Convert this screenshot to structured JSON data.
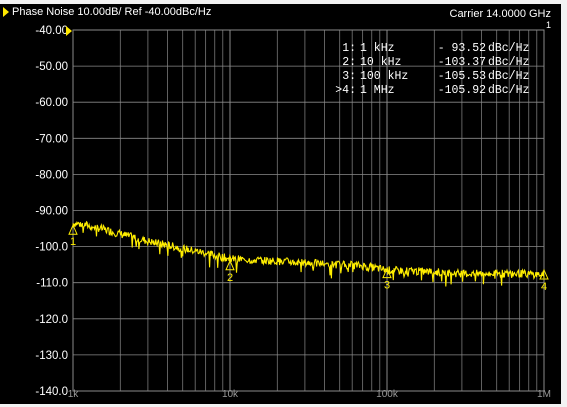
{
  "header": {
    "title": "Phase Noise 10.00dB/ Ref -40.00dBc/Hz",
    "carrier": "Carrier 14.0000 GHz",
    "channel": "1"
  },
  "markers": [
    {
      "label": "1:",
      "freq": "1 kHz",
      "value": "- 93.52",
      "unit": "dBc/Hz",
      "id": "1"
    },
    {
      "label": "2:",
      "freq": "10 kHz",
      "value": "-103.37",
      "unit": "dBc/Hz",
      "id": "2"
    },
    {
      "label": "3:",
      "freq": "100 kHz",
      "value": "-105.53",
      "unit": "dBc/Hz",
      "id": "3"
    },
    {
      "label": ">4:",
      "freq": "1 MHz",
      "value": "-105.92",
      "unit": "dBc/Hz",
      "id": "4"
    }
  ],
  "colors": {
    "trace": "#ffee00",
    "grid": "#8a8a8a",
    "text": "#ffffff",
    "marker": "#ffee00"
  },
  "chart_data": {
    "type": "line",
    "title": "Phase Noise 10.00dB/ Ref -40.00dBc/Hz",
    "xscale": "log",
    "xlim": [
      1000,
      1000000
    ],
    "ylim": [
      -140,
      -40
    ],
    "ytick_labels": [
      "-40.00",
      "-50.00",
      "-60.00",
      "-70.00",
      "-80.00",
      "-90.00",
      "-100.0",
      "-110.0",
      "-120.0",
      "-130.0",
      "-140.0"
    ],
    "xtick_labels": [
      "1k",
      "10k",
      "100k",
      "1M"
    ],
    "grid": true,
    "series": [
      {
        "x": [
          1000,
          1200,
          1500,
          2000,
          3000,
          5000,
          7000,
          10000,
          20000,
          30000,
          50000,
          70000,
          100000,
          200000,
          300000,
          500000,
          700000,
          1000000
        ],
        "y": [
          -93.5,
          -94,
          -95,
          -96.5,
          -98.5,
          -100.5,
          -101.8,
          -103.4,
          -104,
          -104.5,
          -105,
          -105.3,
          -106.5,
          -107,
          -107.5,
          -107.5,
          -107.5,
          -107.8
        ]
      }
    ],
    "marker_points": [
      {
        "id": "1",
        "x": 1000,
        "y": -93.52
      },
      {
        "id": "2",
        "x": 10000,
        "y": -103.37
      },
      {
        "id": "3",
        "x": 100000,
        "y": -105.53
      },
      {
        "id": "4",
        "x": 1000000,
        "y": -105.92
      }
    ]
  }
}
